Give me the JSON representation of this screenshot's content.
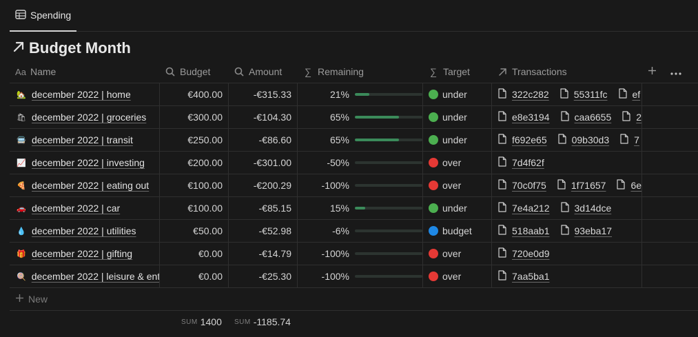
{
  "view_tab": {
    "label": "Spending",
    "icon": "table-icon"
  },
  "page": {
    "title": "Budget Month",
    "icon": "arrow-up-right-icon"
  },
  "columns": {
    "name": "Name",
    "budget": "Budget",
    "amount": "Amount",
    "remaining": "Remaining",
    "target": "Target",
    "transactions": "Transactions"
  },
  "colors": {
    "under": "#4caf50",
    "over": "#e53935",
    "budget": "#1e88e5",
    "bar": "#3b8a5a"
  },
  "rows": [
    {
      "emoji": "🏡",
      "name": "december 2022 | home",
      "budget": "€400.00",
      "amount": "-€315.33",
      "remaining": "21%",
      "remaining_fraction": 0.21,
      "target_status": "under",
      "target": "under",
      "transactions": [
        "322c282",
        "55311fc",
        "ef"
      ]
    },
    {
      "emoji": "🛍",
      "name": "december 2022 | groceries",
      "budget": "€300.00",
      "amount": "-€104.30",
      "remaining": "65%",
      "remaining_fraction": 0.65,
      "target_status": "under",
      "target": "under",
      "transactions": [
        "e8e3194",
        "caa6655",
        "2"
      ]
    },
    {
      "emoji": "🚍",
      "name": "december 2022 | transit",
      "budget": "€250.00",
      "amount": "-€86.60",
      "remaining": "65%",
      "remaining_fraction": 0.65,
      "target_status": "under",
      "target": "under",
      "transactions": [
        "f692e65",
        "09b30d3",
        "7"
      ]
    },
    {
      "emoji": "📈",
      "name": "december 2022 | investing",
      "budget": "€200.00",
      "amount": "-€301.00",
      "remaining": "-50%",
      "remaining_fraction": 0,
      "target_status": "over",
      "target": "over",
      "transactions": [
        "7d4f62f"
      ]
    },
    {
      "emoji": "🍕",
      "name": "december 2022 | eating out",
      "budget": "€100.00",
      "amount": "-€200.29",
      "remaining": "-100%",
      "remaining_fraction": 0,
      "target_status": "over",
      "target": "over",
      "transactions": [
        "70c0f75",
        "1f71657",
        "6e"
      ]
    },
    {
      "emoji": "🚗",
      "name": "december 2022 | car",
      "budget": "€100.00",
      "amount": "-€85.15",
      "remaining": "15%",
      "remaining_fraction": 0.15,
      "target_status": "under",
      "target": "under",
      "transactions": [
        "7e4a212",
        "3d14dce"
      ]
    },
    {
      "emoji": "💧",
      "name": "december 2022 | utilities",
      "budget": "€50.00",
      "amount": "-€52.98",
      "remaining": "-6%",
      "remaining_fraction": 0,
      "target_status": "budget",
      "target": "budget",
      "transactions": [
        "518aab1",
        "93eba17"
      ]
    },
    {
      "emoji": "🎁",
      "name": "december 2022 | gifting",
      "budget": "€0.00",
      "amount": "-€14.79",
      "remaining": "-100%",
      "remaining_fraction": 0,
      "target_status": "over",
      "target": "over",
      "transactions": [
        "720e0d9"
      ]
    },
    {
      "emoji": "🍭",
      "name": "december 2022 | leisure & ent",
      "budget": "€0.00",
      "amount": "-€25.30",
      "remaining": "-100%",
      "remaining_fraction": 0,
      "target_status": "over",
      "target": "over",
      "transactions": [
        "7aa5ba1"
      ]
    }
  ],
  "new_row_label": "New",
  "sums": {
    "label": "SUM",
    "budget": "1400",
    "amount": "-1185.74"
  }
}
